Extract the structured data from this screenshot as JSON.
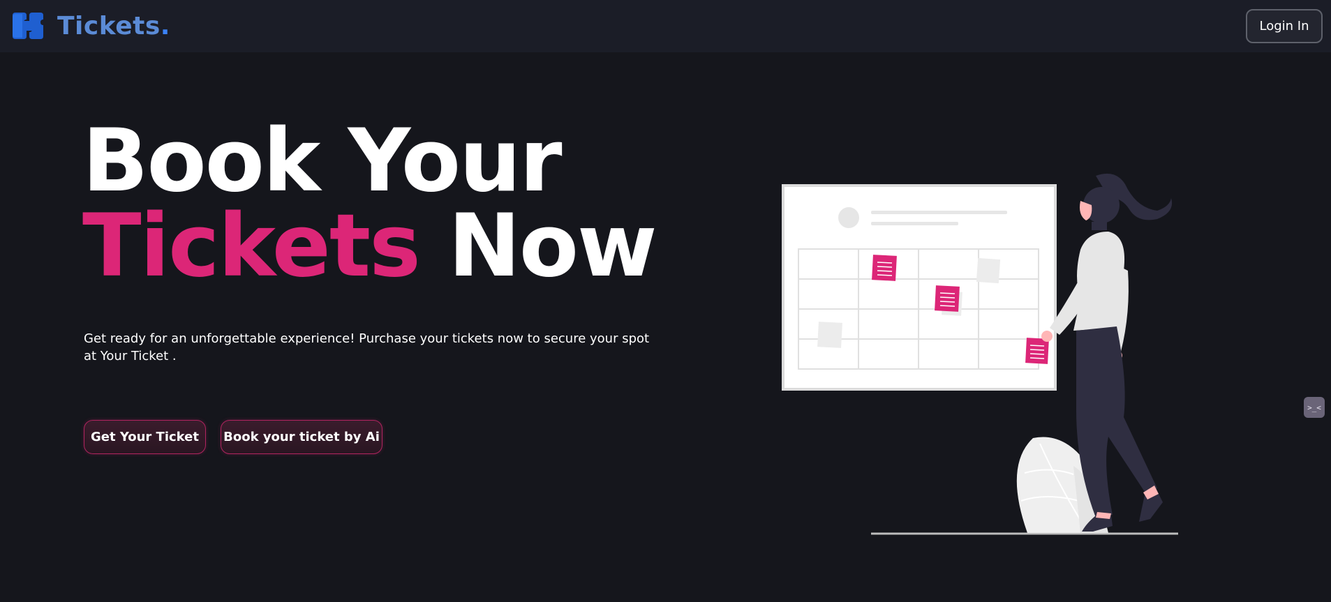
{
  "navbar": {
    "brand_name": "Tickets",
    "brand_dot": ".",
    "brand_icon": "ticket-logo-icon",
    "login_label": "Login In"
  },
  "hero": {
    "title_line1": "Book Your",
    "title_accent": "Tickets",
    "title_rest": " Now",
    "subtitle": "Get ready for an unforgettable experience! Purchase your tickets now to secure your spot at Your Ticket .",
    "cta_primary": "Get Your Ticket",
    "cta_secondary": "Book your ticket by Ai"
  },
  "illustration": {
    "icon": "woman-calendar-illustration"
  },
  "side_widget": {
    "icon": "chat-widget-icon",
    "glyph": ">_<"
  },
  "colors": {
    "background": "#15161c",
    "navbar": "#1b1d27",
    "brand_blue": "#5b8bd6",
    "accent_pink": "#dc2677",
    "text": "#ffffff"
  }
}
